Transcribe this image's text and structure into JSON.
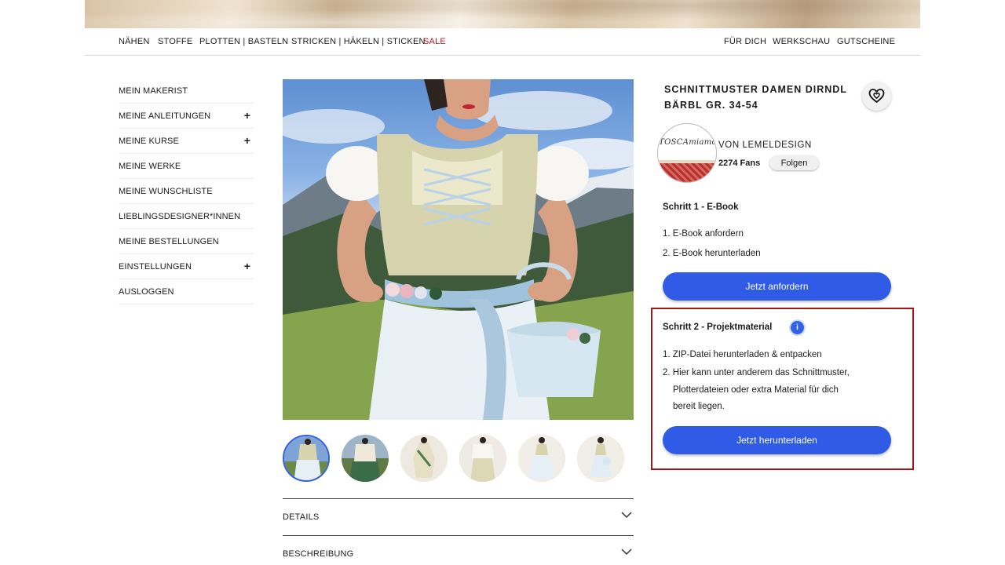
{
  "nav": {
    "left": [
      "NÄHEN",
      "STOFFE",
      "PLOTTEN | BASTELN",
      "STRICKEN | HÄKELN | STICKEN",
      "SALE"
    ],
    "right": [
      "FÜR DICH",
      "WERKSCHAU",
      "GUTSCHEINE"
    ]
  },
  "sidebar": {
    "items": [
      {
        "label": "MEIN MAKERIST",
        "expandable": false
      },
      {
        "label": "MEINE ANLEITUNGEN",
        "expandable": true
      },
      {
        "label": "MEINE KURSE",
        "expandable": true
      },
      {
        "label": "MEINE WERKE",
        "expandable": false
      },
      {
        "label": "MEINE WUNSCHLISTE",
        "expandable": false
      },
      {
        "label": "LIEBLINGSDESIGNER*INNEN",
        "expandable": false
      },
      {
        "label": "MEINE BESTELLUNGEN",
        "expandable": false
      },
      {
        "label": "EINSTELLUNGEN",
        "expandable": true
      },
      {
        "label": "AUSLOGGEN",
        "expandable": false
      }
    ],
    "expand_symbol": "+"
  },
  "product": {
    "title": "SCHNITTMUSTER DAMEN DIRNDL BÄRBL GR. 34-54",
    "designer": {
      "by_label": "VON LEMELDESIGN",
      "fans": "2274 Fans",
      "follow_label": "Folgen",
      "logo_text": "TOSCAmiamo"
    },
    "thumbnail_count": 6,
    "active_thumbnail": 0
  },
  "step1": {
    "heading": "Schritt 1 - E-Book",
    "items": [
      "1. E-Book anfordern",
      "2. E-Book herunterladen"
    ],
    "button_label": "Jetzt anfordern"
  },
  "step2": {
    "heading": "Schritt 2 - Projektmaterial",
    "info_icon": "i",
    "items": [
      "1. ZIP-Datei herunterladen & entpacken",
      "2. Hier kann unter anderem das Schnittmuster,",
      "Plotterdateien oder extra Material für dich",
      "bereit liegen."
    ],
    "button_label": "Jetzt herunterladen"
  },
  "accordion": [
    "DETAILS",
    "BESCHREIBUNG"
  ],
  "colors": {
    "accent": "#2f5be6",
    "sale": "#c8102e",
    "highlight": "#a4151b"
  }
}
